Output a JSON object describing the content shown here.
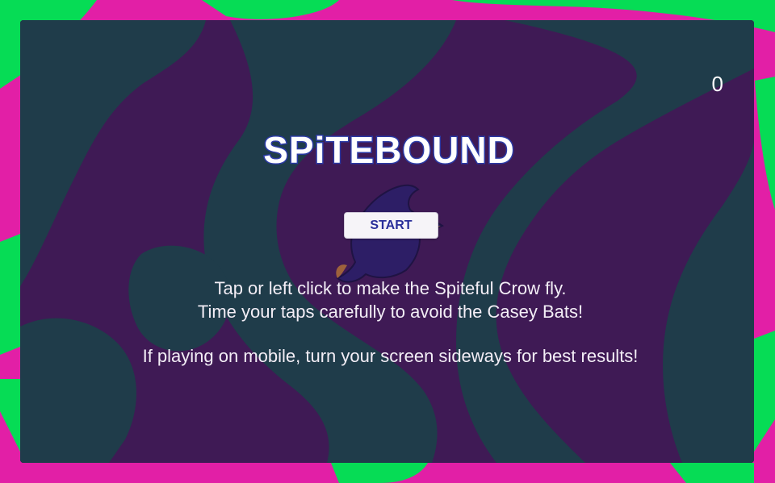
{
  "game": {
    "score": "0",
    "logo_text": "SPiTEBOUND",
    "start_label": "START",
    "instructions": {
      "line1": "Tap or left click to make the Spiteful Crow fly.",
      "line2": "Time your taps carefully to avoid the Casey Bats!",
      "line3": "If playing on mobile, turn your screen sideways for best results!"
    }
  },
  "colors": {
    "background_pink": "#e21fa6",
    "background_green": "#06dc55",
    "panel_purple": "#3f1a55",
    "panel_teal": "#1f3c4a",
    "button_text": "#2a2f9a",
    "logo_fill": "#ffffff",
    "logo_outline": "#2b3aa6"
  },
  "icons": {
    "character": "spiteful-crow-icon"
  }
}
